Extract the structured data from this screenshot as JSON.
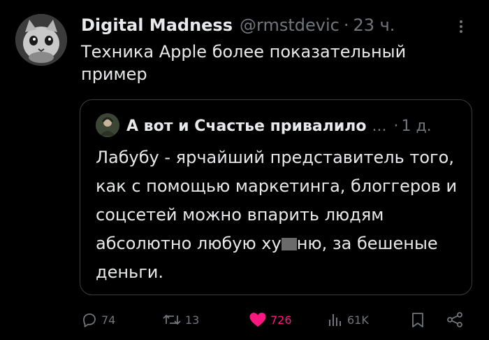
{
  "tweet": {
    "author": {
      "name": "Digital Madness",
      "handle": "@rmstdevic",
      "separator": "·",
      "time": "23 ч."
    },
    "text": "Техника Apple более показательный пример",
    "more_icon": "more-vertical-icon"
  },
  "quote": {
    "author": {
      "name": "А вот и Счастье привалило",
      "ellipsis": "...",
      "separator": "·",
      "time": "1 д."
    },
    "text_before_censor": "Лабубу - ярчайший представитель того, как с помощью маркетинга, блоггеров и соцсетей можно впарить людям абсолютно любую ху",
    "text_after_censor": "ню, за бешеные деньги."
  },
  "actions": {
    "reply": {
      "icon": "reply-icon",
      "count": "74"
    },
    "repost": {
      "icon": "repost-icon",
      "count": "13"
    },
    "like": {
      "icon": "heart-icon",
      "count": "726",
      "liked": true
    },
    "views": {
      "icon": "views-icon",
      "count": "61K"
    },
    "bookmark": {
      "icon": "bookmark-icon"
    },
    "share": {
      "icon": "share-icon"
    }
  },
  "colors": {
    "background": "#000000",
    "text": "#e7e9ea",
    "secondary": "#71767b",
    "like": "#f91880",
    "border": "#3a3d41"
  }
}
